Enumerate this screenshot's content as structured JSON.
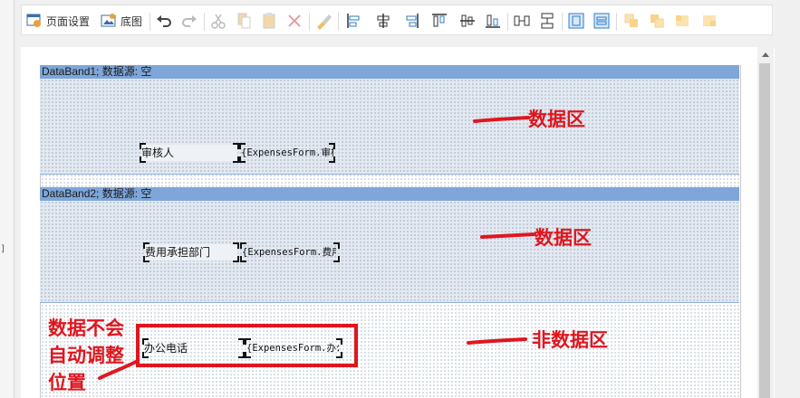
{
  "toolbar": {
    "page_setup_label": "页面设置",
    "background_label": "底图",
    "icons": [
      "undo-icon",
      "redo-icon",
      "cut-icon",
      "copy-icon",
      "paste-icon",
      "delete-icon",
      "format-brush-icon",
      "align-left-icon",
      "align-center-icon",
      "align-right-icon",
      "align-top-icon",
      "align-middle-icon",
      "align-bottom-icon",
      "distribute-horizontal-icon",
      "distribute-vertical-icon",
      "same-width-icon",
      "same-height-icon",
      "bring-front-icon",
      "send-back-icon",
      "lock-icon",
      "unlock-icon"
    ]
  },
  "left_strip_mark": "]",
  "bands": [
    {
      "header": "DataBand1; 数据源: 空",
      "label_cell": "审核人",
      "expr_cell": "{ExpensesForm.审核"
    },
    {
      "header": "DataBand2; 数据源: 空",
      "label_cell": "费用承担部门",
      "expr_cell": "{ExpensesForm.费用"
    }
  ],
  "non_data_row": {
    "label_cell": "办公电话",
    "expr_cell": "{ExpensesForm.办公"
  },
  "annotations": {
    "data_area_1": "数据区",
    "data_area_2": "数据区",
    "non_data_area": "非数据区",
    "note_line1": "数据不会",
    "note_line2": "自动调整",
    "note_line3": "位置"
  },
  "colors": {
    "band_header": "#7ea6d9",
    "band_body": "#e3e9f1",
    "annotation_red": "#e0161e"
  }
}
